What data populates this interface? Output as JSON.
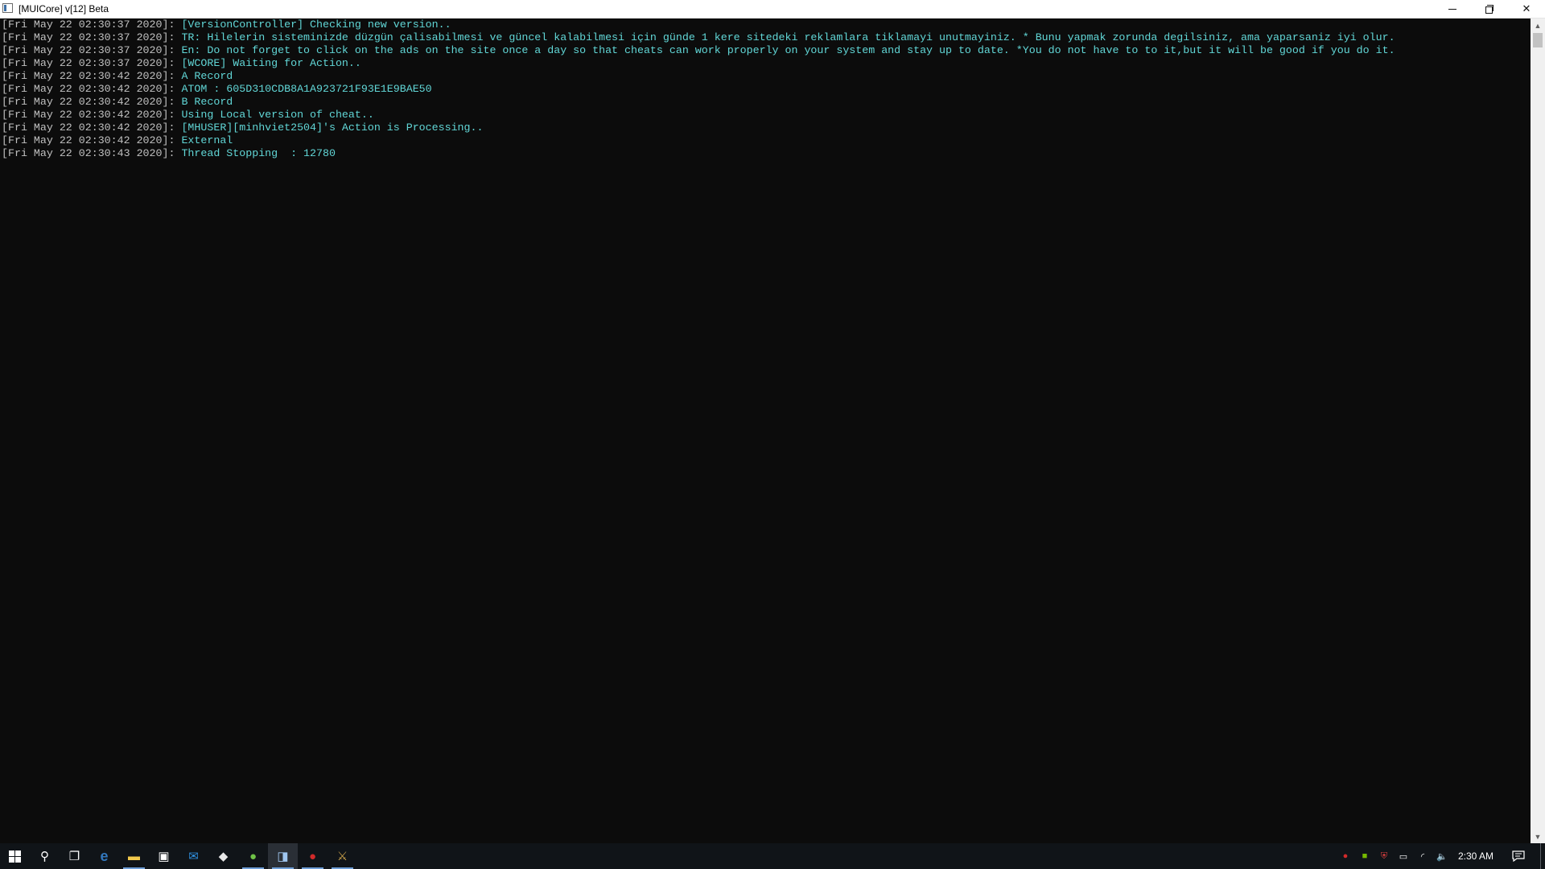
{
  "window": {
    "title": "[MUICore] v[12] Beta",
    "controls": {
      "minimize": "minimize-icon",
      "restore": "restore-icon",
      "close": "✕"
    }
  },
  "console": {
    "colors": {
      "background": "#0c0c0c",
      "timestamp": "#c0c0c0",
      "message": "#61d6d6"
    },
    "lines": [
      {
        "ts": "[Fri May 22 02:30:37 2020]: ",
        "msg": "[VersionController] Checking new version.."
      },
      {
        "ts": "[Fri May 22 02:30:37 2020]: ",
        "msg": "TR: Hilelerin sisteminizde düzgün çalisabilmesi ve güncel kalabilmesi için günde 1 kere sitedeki reklamlara tiklamayi unutmayiniz. * Bunu yapmak zorunda degilsiniz, ama yaparsaniz iyi olur."
      },
      {
        "ts": "[Fri May 22 02:30:37 2020]: ",
        "msg": "En: Do not forget to click on the ads on the site once a day so that cheats can work properly on your system and stay up to date. *You do not have to to it,but it will be good if you do it."
      },
      {
        "ts": "[Fri May 22 02:30:37 2020]: ",
        "msg": "[WCORE] Waiting for Action.."
      },
      {
        "ts": "[Fri May 22 02:30:42 2020]: ",
        "msg": "A Record"
      },
      {
        "ts": "[Fri May 22 02:30:42 2020]: ",
        "msg": "ATOM : 605D310CDB8A1A923721F93E1E9BAE50"
      },
      {
        "ts": "[Fri May 22 02:30:42 2020]: ",
        "msg": "B Record"
      },
      {
        "ts": "[Fri May 22 02:30:42 2020]: ",
        "msg": "Using Local version of cheat.."
      },
      {
        "ts": "[Fri May 22 02:30:42 2020]: ",
        "msg": "[MHUSER][minhviet2504]'s Action is Processing.."
      },
      {
        "ts": "[Fri May 22 02:30:42 2020]: ",
        "msg": "External"
      },
      {
        "ts": "[Fri May 22 02:30:43 2020]: ",
        "msg": "Thread Stopping  : 12780"
      }
    ]
  },
  "scrollbar": {
    "up": "▲",
    "down": "▼"
  },
  "taskbar": {
    "items": [
      {
        "name": "start-button",
        "icon": "windows-logo-icon"
      },
      {
        "name": "search-button",
        "icon": "search-icon",
        "glyph": "⚲"
      },
      {
        "name": "task-view-button",
        "icon": "task-view-icon",
        "glyph": "❐"
      },
      {
        "name": "edge-button",
        "icon": "edge-icon",
        "glyph": "e",
        "color": "#3277bc"
      },
      {
        "name": "file-explorer-button",
        "icon": "folder-icon",
        "glyph": "▬",
        "color": "#f2c94c",
        "running": true
      },
      {
        "name": "store-button",
        "icon": "store-icon",
        "glyph": "▣",
        "color": "#ffffff"
      },
      {
        "name": "mail-button",
        "icon": "mail-icon",
        "glyph": "✉",
        "color": "#2f8fdf"
      },
      {
        "name": "app-button-1",
        "icon": "app-icon",
        "glyph": "◆",
        "color": "#e8e8e8"
      },
      {
        "name": "app-button-2",
        "icon": "green-app-icon",
        "glyph": "●",
        "color": "#6fc247",
        "running": true
      },
      {
        "name": "console-button",
        "icon": "console-window-icon",
        "glyph": "◨",
        "color": "#9fc6f0",
        "running": true,
        "active": true
      },
      {
        "name": "app-button-3",
        "icon": "red-app-icon",
        "glyph": "●",
        "color": "#d12a2a",
        "running": true
      },
      {
        "name": "app-button-4",
        "icon": "league-icon",
        "glyph": "⚔",
        "color": "#c9a14a",
        "running": true
      }
    ],
    "tray": [
      {
        "name": "tray-red-app",
        "icon": "red-app-icon",
        "glyph": "●",
        "color": "#d12a2a"
      },
      {
        "name": "tray-nvidia",
        "icon": "nvidia-icon",
        "glyph": "■",
        "color": "#76b900"
      },
      {
        "name": "tray-shield",
        "icon": "shield-icon",
        "glyph": "⛨",
        "color": "#e04040"
      },
      {
        "name": "tray-battery",
        "icon": "battery-icon",
        "glyph": "▭",
        "color": "#ffffff"
      },
      {
        "name": "tray-network",
        "icon": "wifi-icon",
        "glyph": "◜",
        "color": "#ffffff"
      },
      {
        "name": "tray-volume",
        "icon": "speaker-icon",
        "glyph": "🔈",
        "color": "#ffffff"
      }
    ],
    "clock": "2:30 AM",
    "notification": "notification-icon"
  }
}
